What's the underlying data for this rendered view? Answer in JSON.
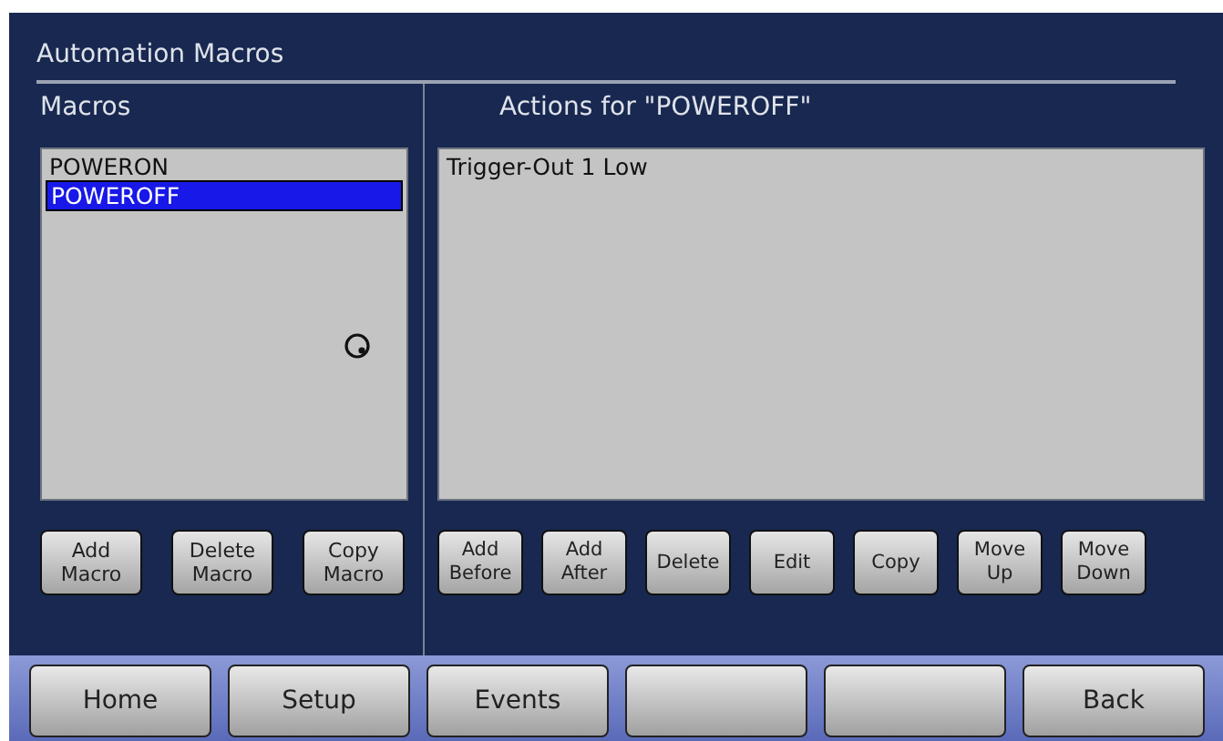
{
  "title": "Automation Macros",
  "macros": {
    "label": "Macros",
    "items": [
      {
        "text": "POWERON",
        "selected": false
      },
      {
        "text": "POWEROFF",
        "selected": true
      }
    ],
    "buttons": [
      "Add Macro",
      "Delete Macro",
      "Copy Macro"
    ]
  },
  "actions": {
    "label": "Actions for \"POWEROFF\"",
    "items": [
      {
        "text": "Trigger-Out 1 Low",
        "selected": false
      }
    ],
    "buttons": [
      "Add Before",
      "Add After",
      "Delete",
      "Edit",
      "Copy",
      "Move Up",
      "Move Down"
    ]
  },
  "nav": [
    {
      "kind": "labeled",
      "label": "Home"
    },
    {
      "kind": "labeled",
      "label": "Setup"
    },
    {
      "kind": "labeled",
      "label": "Events"
    },
    {
      "kind": "blank"
    },
    {
      "kind": "blank"
    },
    {
      "kind": "labeled",
      "label": "Back"
    }
  ]
}
